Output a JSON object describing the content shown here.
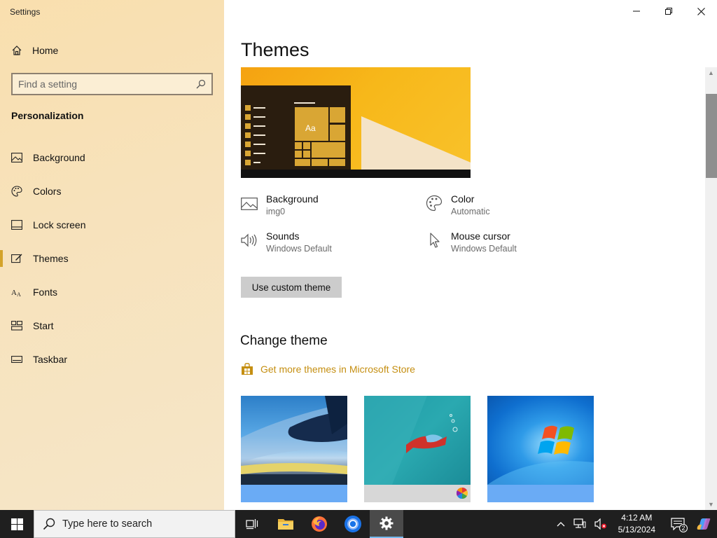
{
  "window": {
    "title": "Settings"
  },
  "sidebar": {
    "home_label": "Home",
    "search_placeholder": "Find a setting",
    "section_title": "Personalization",
    "items": [
      {
        "label": "Background",
        "icon": "picture-icon",
        "active": false
      },
      {
        "label": "Colors",
        "icon": "palette-icon",
        "active": false
      },
      {
        "label": "Lock screen",
        "icon": "lock-screen-icon",
        "active": false
      },
      {
        "label": "Themes",
        "icon": "themes-icon",
        "active": true
      },
      {
        "label": "Fonts",
        "icon": "fonts-icon",
        "active": false
      },
      {
        "label": "Start",
        "icon": "start-icon",
        "active": false
      },
      {
        "label": "Taskbar",
        "icon": "taskbar-icon",
        "active": false
      }
    ]
  },
  "main": {
    "title": "Themes",
    "preview_sample_text": "Aa",
    "properties": {
      "background": {
        "name": "Background",
        "value": "img0"
      },
      "color": {
        "name": "Color",
        "value": "Automatic"
      },
      "sounds": {
        "name": "Sounds",
        "value": "Windows Default"
      },
      "mouse_cursor": {
        "name": "Mouse cursor",
        "value": "Windows Default"
      }
    },
    "custom_theme_button": "Use custom theme",
    "change_theme_title": "Change theme",
    "store_link": "Get more themes in Microsoft Store",
    "themes": [
      {
        "label": "",
        "strip_color": "#6aabf5"
      },
      {
        "label": "",
        "strip_color": "#d7d7d7"
      },
      {
        "label": "",
        "strip_color": "#6aabf5"
      }
    ]
  },
  "taskbar": {
    "search_placeholder": "Type here to search",
    "time": "4:12 AM",
    "date": "5/13/2024",
    "notification_count": "2"
  },
  "colors": {
    "accent": "#c58f12",
    "taskbar_bg": "#1f1f1f"
  }
}
